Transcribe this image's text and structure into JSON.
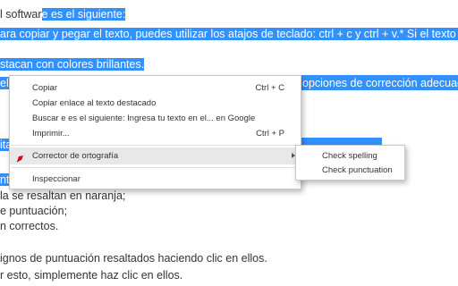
{
  "document": {
    "line1_plain": "l softwar",
    "line1_selected": "e es el siguiente:",
    "line2_selected": "ara copiar y pegar el texto, puedes utilizar los atajos de teclado: ctrl + c y ctrl + v.* Si el texto es",
    "line3_selected": "stacan con colores brillantes.",
    "line4_left_selected": "el",
    "line4_right_selected": "opciones de corrección adecuada",
    "line5_left_selected": "ita",
    "line5_right_selected": "",
    "line6_left_selected": "nt",
    "line7": "la se resaltan en naranja;",
    "line8": "e puntuación;",
    "line9": "n correctos.",
    "line10": "ignos de puntuación resaltados haciendo clic en ellos.",
    "line11": "r esto, simplemente haz clic en ellos."
  },
  "context_menu": {
    "copy_label": "Copiar",
    "copy_shortcut": "Ctrl + C",
    "copy_link_label": "Copiar enlace al texto destacado",
    "search_label": "Buscar e es el siguiente:  Ingresa tu texto en el... en Google",
    "print_label": "Imprimir...",
    "print_shortcut": "Ctrl + P",
    "spellcheck_label": "Corrector de ortografía",
    "spellcheck_icon": "red-pen-icon",
    "submenu_arrow_icon": "chevron-right-icon",
    "inspect_label": "Inspeccionar"
  },
  "submenu": {
    "check_spelling_label": "Check spelling",
    "check_punctuation_label": "Check punctuation"
  },
  "colors": {
    "selection": "#3390ff",
    "menu_hover": "#e8e8e8",
    "spell_icon": "#e0001b"
  }
}
